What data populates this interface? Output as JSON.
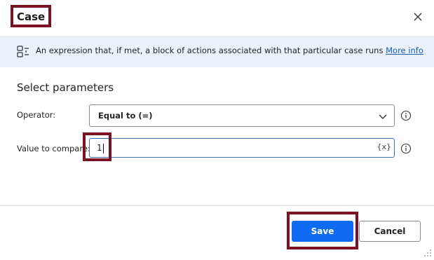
{
  "dialog": {
    "title": "Case",
    "close_icon": "close-icon"
  },
  "info": {
    "icon": "info-list-icon",
    "text": "An expression that, if met, a block of actions associated with that particular case runs ",
    "link_label": "More info"
  },
  "section": {
    "title": "Select parameters"
  },
  "fields": {
    "operator": {
      "label": "Operator:",
      "value": "Equal to (=)",
      "icon": "chevron-down-icon",
      "help_icon": "info-circle-icon"
    },
    "value_to_compare": {
      "label": "Value to compare:",
      "value": "1",
      "variable_button": "{x}",
      "help_icon": "info-circle-icon"
    }
  },
  "footer": {
    "save_label": "Save",
    "cancel_label": "Cancel"
  },
  "colors": {
    "accent": "#0f6cf0",
    "highlight_border": "#7a1224",
    "info_bar": "#eaf1fb",
    "link": "#1a5fb4"
  }
}
